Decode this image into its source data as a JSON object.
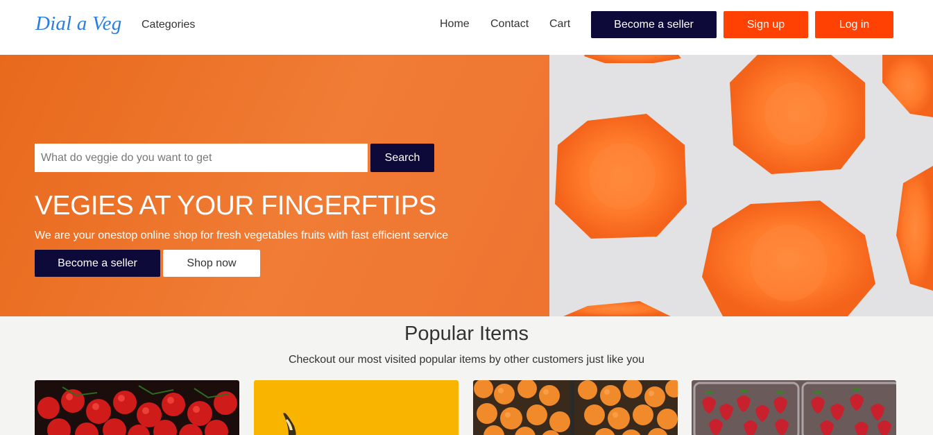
{
  "nav": {
    "brand": "Dial a Veg",
    "categories": "Categories",
    "links": {
      "home": "Home",
      "contact": "Contact",
      "cart": "Cart"
    },
    "become_seller": "Become a seller",
    "signup": "Sign up",
    "login": "Log in"
  },
  "hero": {
    "search_placeholder": "What do veggie do you want to get",
    "search_button": "Search",
    "title": "VEGIES AT YOUR FINGERFTIPS",
    "subtitle": "We are your onestop online shop for fresh vegetables fruits with fast efficient service",
    "become_seller": "Become a seller",
    "shop_now": "Shop now"
  },
  "popular": {
    "title": "Popular Items",
    "subtitle": "Checkout our most visited popular items by other customers just like you",
    "items": [
      {
        "image": "tomatoes-image"
      },
      {
        "image": "banana-yellow-image"
      },
      {
        "image": "oranges-image"
      },
      {
        "image": "strawberries-image"
      }
    ]
  },
  "colors": {
    "brand_blue": "#2a7de1",
    "navy": "#0d0a3a",
    "accent_orange": "#ff4104",
    "hero_orange": "#ee7430"
  }
}
